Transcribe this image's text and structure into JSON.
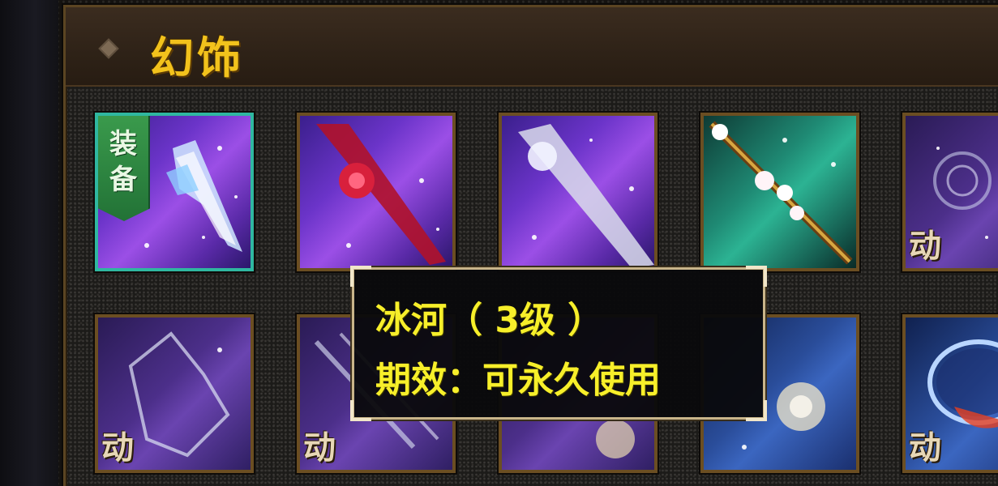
{
  "panel": {
    "title": "幻饰"
  },
  "equip_badge": {
    "char1": "装",
    "char2": "备"
  },
  "dynamic_tag": "动",
  "items_row1": [
    {
      "name": "冰河",
      "theme": "violet",
      "equipped": true,
      "dynamic": false
    },
    {
      "theme": "violet",
      "equipped": false,
      "dynamic": false
    },
    {
      "theme": "violet",
      "equipped": false,
      "dynamic": false
    },
    {
      "theme": "teal",
      "equipped": false,
      "dynamic": false
    },
    {
      "theme": "dim",
      "equipped": false,
      "dynamic": true
    }
  ],
  "items_row2": [
    {
      "theme": "dim",
      "dynamic": true
    },
    {
      "theme": "dim",
      "dynamic": true
    },
    {
      "theme": "dim",
      "dynamic": false
    },
    {
      "theme": "navy",
      "dynamic": false
    },
    {
      "theme": "navy",
      "dynamic": true
    }
  ],
  "tooltip": {
    "line1": "冰河（ 3级 ）",
    "line2": "期效：可永久使用"
  },
  "colors": {
    "title": "#f2c21c",
    "tooltip_text": "#f7ef2a",
    "equipped_border": "#2fb7a0",
    "slot_border": "#6b4e22"
  }
}
